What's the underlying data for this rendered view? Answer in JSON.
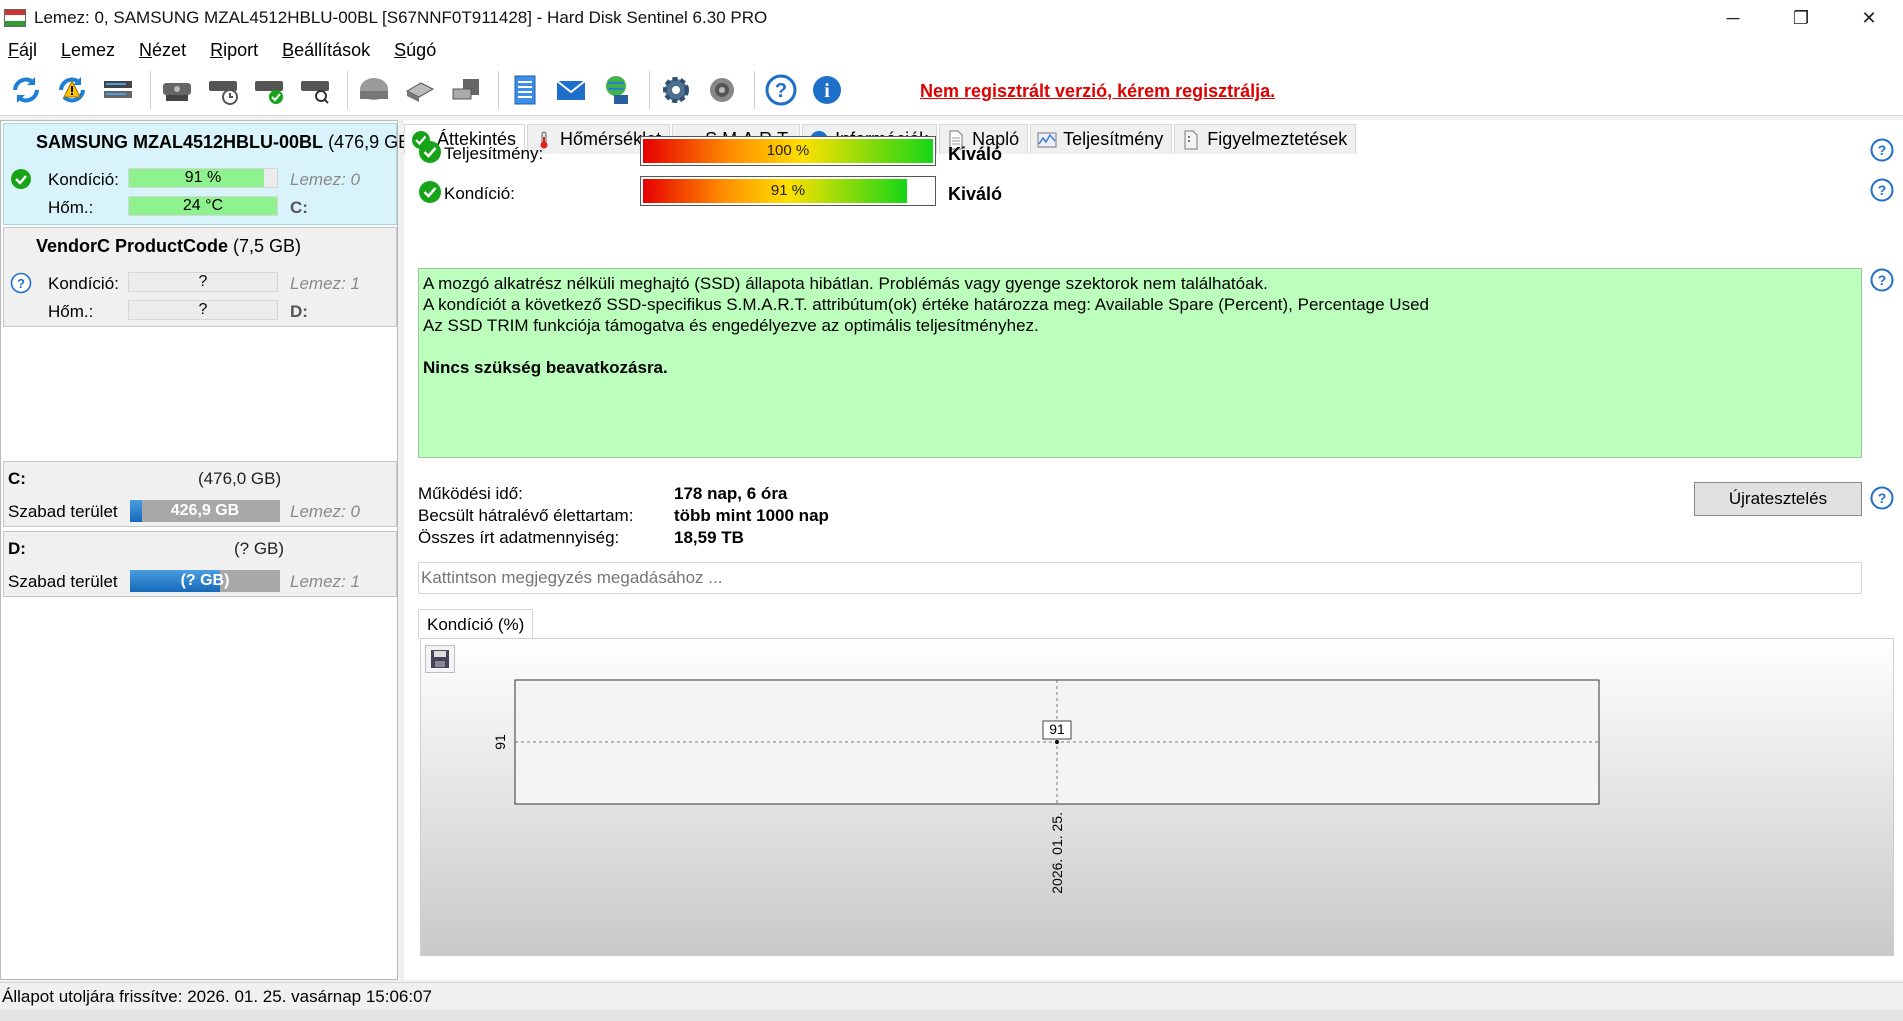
{
  "window": {
    "title": "Lemez: 0, SAMSUNG MZAL4512HBLU-00BL [S67NNF0T911428]  -  Hard Disk Sentinel 6.30 PRO",
    "minimize": "─",
    "restore": "❐",
    "close": "✕"
  },
  "menu": {
    "items": [
      {
        "underline": "F",
        "rest": "ájl"
      },
      {
        "underline": "L",
        "rest": "emez"
      },
      {
        "underline": "N",
        "rest": "ézet"
      },
      {
        "underline": "R",
        "rest": "iport"
      },
      {
        "underline": "B",
        "rest": "eállítások"
      },
      {
        "underline": "S",
        "rest": "úgó"
      }
    ]
  },
  "toolbar": {
    "register_link": "Nem regisztrált verzió, kérem regisztrálja.",
    "colors": {
      "link": "#e00000"
    }
  },
  "disks": [
    {
      "name": "SAMSUNG MZAL4512HBLU-00BL",
      "size": "(476,9 GB",
      "status": "ok",
      "condition_label": "Kondíció:",
      "condition_value": "91 %",
      "condition_fraction": 0.91,
      "temp_label": "Hőm.:",
      "temp_value": "24 °C",
      "temp_fraction": 1.0,
      "disk_label": "Lemez: 0",
      "drive_letter": "C:"
    },
    {
      "name": "VendorC ProductCode",
      "size": "(7,5 GB)",
      "status": "unknown",
      "condition_label": "Kondíció:",
      "condition_value": "?",
      "condition_fraction": 0,
      "temp_label": "Hőm.:",
      "temp_value": "?",
      "temp_fraction": 0,
      "disk_label": "Lemez: 1",
      "drive_letter": "D:"
    }
  ],
  "volumes": [
    {
      "letter": "C:",
      "size": "(476,0 GB)",
      "free_label": "Szabad terület",
      "free_value": "426,9 GB",
      "free_fraction": 0.08,
      "disk_label": "Lemez: 0"
    },
    {
      "letter": "D:",
      "size": "(? GB)",
      "free_label": "Szabad terület",
      "free_value": "(? GB)",
      "free_fraction": 0.6,
      "disk_label": "Lemez: 1"
    }
  ],
  "tabs": [
    {
      "label": "Áttekintés",
      "icon": "check-icon",
      "active": true
    },
    {
      "label": "Hőmérséklet",
      "icon": "thermometer-icon",
      "active": false
    },
    {
      "label": "S.M.A.R.T.",
      "icon": "disk-icon",
      "active": false
    },
    {
      "label": "Információk",
      "icon": "info-icon",
      "active": false
    },
    {
      "label": "Napló",
      "icon": "document-icon",
      "active": false
    },
    {
      "label": "Teljesítmény",
      "icon": "performance-chart-icon",
      "active": false
    },
    {
      "label": "Figyelmeztetések",
      "icon": "alerts-icon",
      "active": false
    }
  ],
  "overview": {
    "performance_label": "Teljesítmény:",
    "performance_value": "100 %",
    "performance_fraction": 1.0,
    "performance_rating": "Kiváló",
    "condition_label": "Kondíció:",
    "condition_value": "91 %",
    "condition_fraction": 0.91,
    "condition_rating": "Kiváló",
    "info_lines": [
      "A mozgó alkatrész nélküli meghajtó (SSD) állapota hibátlan. Problémás vagy gyenge szektorok nem találhatóak.",
      "A kondíciót a következő SSD-specifikus S.M.A.R.T. attribútum(ok) értéke határozza meg:  Available Spare (Percent), Percentage Used",
      "Az SSD TRIM funkciója támogatva és engedélyezve az optimális teljesítményhez."
    ],
    "info_bold": "Nincs szükség beavatkozásra.",
    "uptime_label": "Működési idő:",
    "uptime_value": "178 nap, 6 óra",
    "lifetime_label": "Becsült hátralévő élettartam:",
    "lifetime_value": "több mint 1000 nap",
    "written_label": "Összes írt adatmennyiség:",
    "written_value": "18,59 TB",
    "retest_button": "Újratesztelés",
    "note_placeholder": "Kattintson megjegyzés megadásához ..."
  },
  "chart_tab": "Kondíció  (%)",
  "chart_data": {
    "type": "line",
    "x": [
      "2026. 01. 25."
    ],
    "series": [
      {
        "values": [
          91
        ]
      }
    ],
    "y_ticks": [
      "91"
    ],
    "data_labels": [
      "91"
    ],
    "grid": true
  },
  "statusbar": {
    "text": "Állapot utoljára frissítve: 2026. 01. 25. vasárnap 15:06:07"
  }
}
